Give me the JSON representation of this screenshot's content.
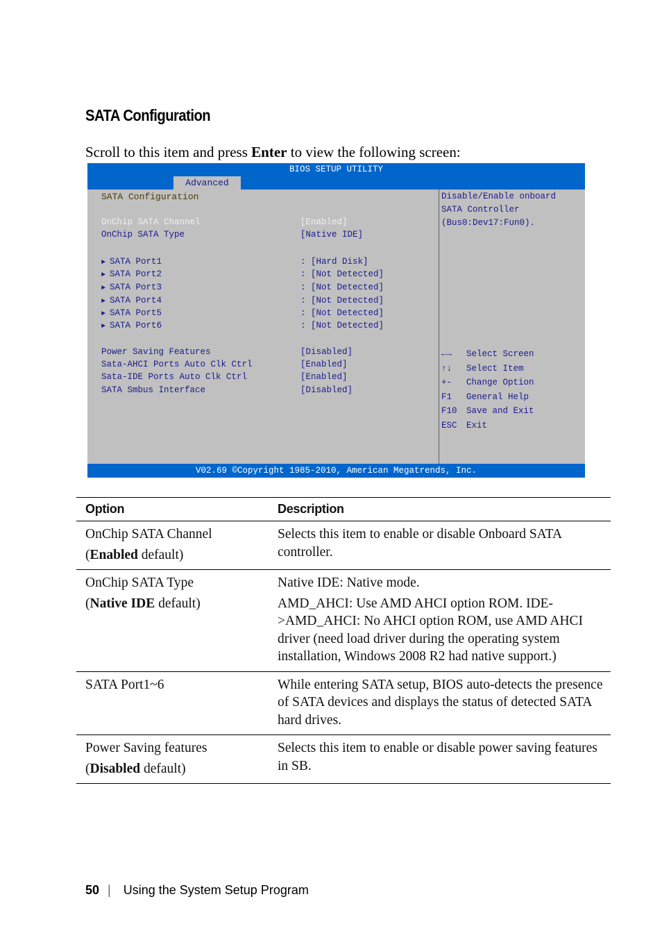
{
  "section_title": "SATA Configuration",
  "intro": {
    "before": "Scroll to this item and press ",
    "key": "Enter",
    "after": " to view the following screen:"
  },
  "bios": {
    "title": "BIOS SETUP UTILITY",
    "active_tab": "Advanced",
    "page_title": "SATA Configuration",
    "colors": {
      "header": "#0066cc",
      "panel": "#c0c0c0",
      "text": "#1a1a8c"
    },
    "settings": [
      {
        "label": "OnChip SATA Channel",
        "value": "[Enabled]",
        "selected": true
      },
      {
        "label": "OnChip SATA Type",
        "value": "[Native IDE]",
        "selected": false
      }
    ],
    "ports": [
      {
        "label": "SATA Port1",
        "value": ": [Hard Disk]"
      },
      {
        "label": "SATA Port2",
        "value": ": [Not Detected]"
      },
      {
        "label": "SATA Port3",
        "value": ": [Not Detected]"
      },
      {
        "label": "SATA Port4",
        "value": ": [Not Detected]"
      },
      {
        "label": "SATA Port5",
        "value": ": [Not Detected]"
      },
      {
        "label": "SATA Port6",
        "value": ": [Not Detected]"
      }
    ],
    "power_settings": [
      {
        "label": "Power Saving Features",
        "value": "[Disabled]"
      },
      {
        "label": "Sata-AHCI Ports Auto Clk Ctrl",
        "value": "[Enabled]"
      },
      {
        "label": "Sata-IDE Ports Auto Clk Ctrl",
        "value": "[Enabled]"
      },
      {
        "label": "SATA Smbus Interface",
        "value": "[Disabled]"
      }
    ],
    "help_text": [
      "Disable/Enable onboard",
      "SATA Controller",
      "(Bus0:Dev17:Fun0)."
    ],
    "key_help": [
      {
        "key": "←→",
        "action": "Select Screen"
      },
      {
        "key": "↑↓",
        "action": "Select Item"
      },
      {
        "key": "+-",
        "action": "Change Option"
      },
      {
        "key": "F1",
        "action": "General Help"
      },
      {
        "key": "F10",
        "action": "Save and Exit"
      },
      {
        "key": "ESC",
        "action": "Exit"
      }
    ],
    "footer": "V02.69 ©Copyright 1985-2010, American Megatrends, Inc."
  },
  "table": {
    "headers": [
      "Option",
      "Description"
    ],
    "rows": [
      {
        "option": "OnChip SATA Channel",
        "default_bold": "Enabled",
        "default_suffix": " default)",
        "description": [
          "Selects this item to enable or disable Onboard SATA controller."
        ]
      },
      {
        "option": "OnChip SATA Type",
        "default_bold": "Native IDE",
        "default_suffix": " default)",
        "description": [
          "Native IDE: Native mode.",
          "AMD_AHCI: Use AMD AHCI option ROM. IDE->AMD_AHCI: No AHCI option ROM, use AMD AHCI driver (need load driver during the operating system installation, Windows 2008 R2 had native support.)"
        ]
      },
      {
        "option": "SATA Port1~6",
        "default_bold": null,
        "default_suffix": null,
        "description": [
          "While entering SATA setup, BIOS auto-detects the presence of SATA devices and displays the status of detected SATA hard drives."
        ]
      },
      {
        "option": "Power Saving features",
        "default_bold": "Disabled",
        "default_suffix": " default)",
        "description": [
          "Selects this item to enable or disable power saving features in SB."
        ]
      }
    ]
  },
  "footer": {
    "page_number": "50",
    "separator": "|",
    "chapter": "Using the System Setup Program"
  }
}
